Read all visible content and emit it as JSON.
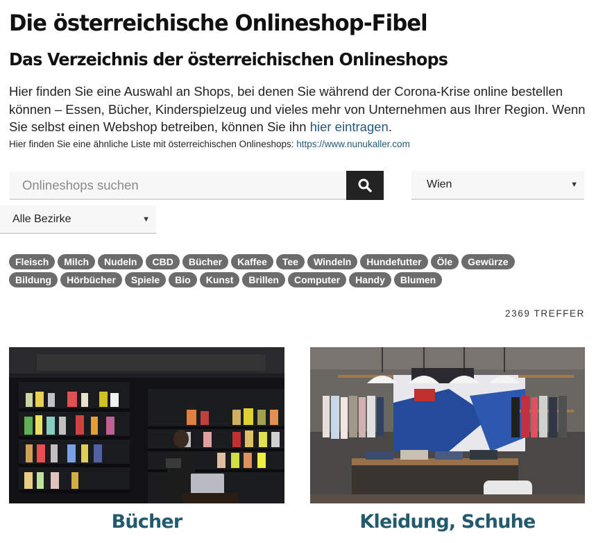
{
  "header": {
    "title": "Die österreichische Onlineshop-Fibel",
    "subtitle": "Das Verzeichnis der österreichischen Onlineshops"
  },
  "intro": {
    "text": "Hier finden Sie eine Auswahl an Shops, bei denen Sie während der Corona-Krise online bestellen können – Essen, Bücher, Kinderspielzeug und vieles mehr von Unternehmen aus Ihrer Region. Wenn Sie selbst einen Webshop betreiben, können Sie ihn ",
    "link_label": "hier eintragen",
    "suffix": "."
  },
  "note": {
    "text": "Hier finden Sie eine ähnliche Liste mit österreichischen Onlineshops: ",
    "link_label": "https://www.nunukaller.com"
  },
  "search": {
    "placeholder": "Onlineshops suchen",
    "button_icon": "search-icon"
  },
  "filters": {
    "region": "Wien",
    "district": "Alle Bezirke"
  },
  "tags": {
    "row1": [
      "Fleisch",
      "Milch",
      "Nudeln",
      "CBD",
      "Bücher",
      "Kaffee",
      "Tee",
      "Windeln",
      "Hundefutter",
      "Öle",
      "Gewürze"
    ],
    "row2": [
      "Bildung",
      "Hörbücher",
      "Spiele",
      "Bio",
      "Kunst",
      "Brillen",
      "Computer",
      "Handy",
      "Blumen"
    ]
  },
  "results": {
    "count_label": "2369 TREFFER"
  },
  "categories": [
    {
      "title": "Bücher"
    },
    {
      "title": "Kleidung, Schuhe"
    }
  ]
}
